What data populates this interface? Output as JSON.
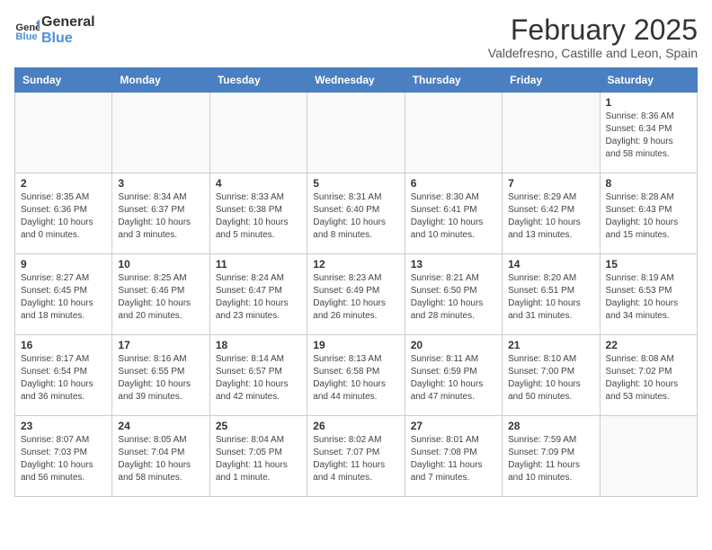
{
  "header": {
    "logo_line1": "General",
    "logo_line2": "Blue",
    "month": "February 2025",
    "location": "Valdefresno, Castille and Leon, Spain"
  },
  "weekdays": [
    "Sunday",
    "Monday",
    "Tuesday",
    "Wednesday",
    "Thursday",
    "Friday",
    "Saturday"
  ],
  "weeks": [
    [
      {
        "day": "",
        "info": ""
      },
      {
        "day": "",
        "info": ""
      },
      {
        "day": "",
        "info": ""
      },
      {
        "day": "",
        "info": ""
      },
      {
        "day": "",
        "info": ""
      },
      {
        "day": "",
        "info": ""
      },
      {
        "day": "1",
        "info": "Sunrise: 8:36 AM\nSunset: 6:34 PM\nDaylight: 9 hours\nand 58 minutes."
      }
    ],
    [
      {
        "day": "2",
        "info": "Sunrise: 8:35 AM\nSunset: 6:36 PM\nDaylight: 10 hours\nand 0 minutes."
      },
      {
        "day": "3",
        "info": "Sunrise: 8:34 AM\nSunset: 6:37 PM\nDaylight: 10 hours\nand 3 minutes."
      },
      {
        "day": "4",
        "info": "Sunrise: 8:33 AM\nSunset: 6:38 PM\nDaylight: 10 hours\nand 5 minutes."
      },
      {
        "day": "5",
        "info": "Sunrise: 8:31 AM\nSunset: 6:40 PM\nDaylight: 10 hours\nand 8 minutes."
      },
      {
        "day": "6",
        "info": "Sunrise: 8:30 AM\nSunset: 6:41 PM\nDaylight: 10 hours\nand 10 minutes."
      },
      {
        "day": "7",
        "info": "Sunrise: 8:29 AM\nSunset: 6:42 PM\nDaylight: 10 hours\nand 13 minutes."
      },
      {
        "day": "8",
        "info": "Sunrise: 8:28 AM\nSunset: 6:43 PM\nDaylight: 10 hours\nand 15 minutes."
      }
    ],
    [
      {
        "day": "9",
        "info": "Sunrise: 8:27 AM\nSunset: 6:45 PM\nDaylight: 10 hours\nand 18 minutes."
      },
      {
        "day": "10",
        "info": "Sunrise: 8:25 AM\nSunset: 6:46 PM\nDaylight: 10 hours\nand 20 minutes."
      },
      {
        "day": "11",
        "info": "Sunrise: 8:24 AM\nSunset: 6:47 PM\nDaylight: 10 hours\nand 23 minutes."
      },
      {
        "day": "12",
        "info": "Sunrise: 8:23 AM\nSunset: 6:49 PM\nDaylight: 10 hours\nand 26 minutes."
      },
      {
        "day": "13",
        "info": "Sunrise: 8:21 AM\nSunset: 6:50 PM\nDaylight: 10 hours\nand 28 minutes."
      },
      {
        "day": "14",
        "info": "Sunrise: 8:20 AM\nSunset: 6:51 PM\nDaylight: 10 hours\nand 31 minutes."
      },
      {
        "day": "15",
        "info": "Sunrise: 8:19 AM\nSunset: 6:53 PM\nDaylight: 10 hours\nand 34 minutes."
      }
    ],
    [
      {
        "day": "16",
        "info": "Sunrise: 8:17 AM\nSunset: 6:54 PM\nDaylight: 10 hours\nand 36 minutes."
      },
      {
        "day": "17",
        "info": "Sunrise: 8:16 AM\nSunset: 6:55 PM\nDaylight: 10 hours\nand 39 minutes."
      },
      {
        "day": "18",
        "info": "Sunrise: 8:14 AM\nSunset: 6:57 PM\nDaylight: 10 hours\nand 42 minutes."
      },
      {
        "day": "19",
        "info": "Sunrise: 8:13 AM\nSunset: 6:58 PM\nDaylight: 10 hours\nand 44 minutes."
      },
      {
        "day": "20",
        "info": "Sunrise: 8:11 AM\nSunset: 6:59 PM\nDaylight: 10 hours\nand 47 minutes."
      },
      {
        "day": "21",
        "info": "Sunrise: 8:10 AM\nSunset: 7:00 PM\nDaylight: 10 hours\nand 50 minutes."
      },
      {
        "day": "22",
        "info": "Sunrise: 8:08 AM\nSunset: 7:02 PM\nDaylight: 10 hours\nand 53 minutes."
      }
    ],
    [
      {
        "day": "23",
        "info": "Sunrise: 8:07 AM\nSunset: 7:03 PM\nDaylight: 10 hours\nand 56 minutes."
      },
      {
        "day": "24",
        "info": "Sunrise: 8:05 AM\nSunset: 7:04 PM\nDaylight: 10 hours\nand 58 minutes."
      },
      {
        "day": "25",
        "info": "Sunrise: 8:04 AM\nSunset: 7:05 PM\nDaylight: 11 hours\nand 1 minute."
      },
      {
        "day": "26",
        "info": "Sunrise: 8:02 AM\nSunset: 7:07 PM\nDaylight: 11 hours\nand 4 minutes."
      },
      {
        "day": "27",
        "info": "Sunrise: 8:01 AM\nSunset: 7:08 PM\nDaylight: 11 hours\nand 7 minutes."
      },
      {
        "day": "28",
        "info": "Sunrise: 7:59 AM\nSunset: 7:09 PM\nDaylight: 11 hours\nand 10 minutes."
      },
      {
        "day": "",
        "info": ""
      }
    ]
  ]
}
